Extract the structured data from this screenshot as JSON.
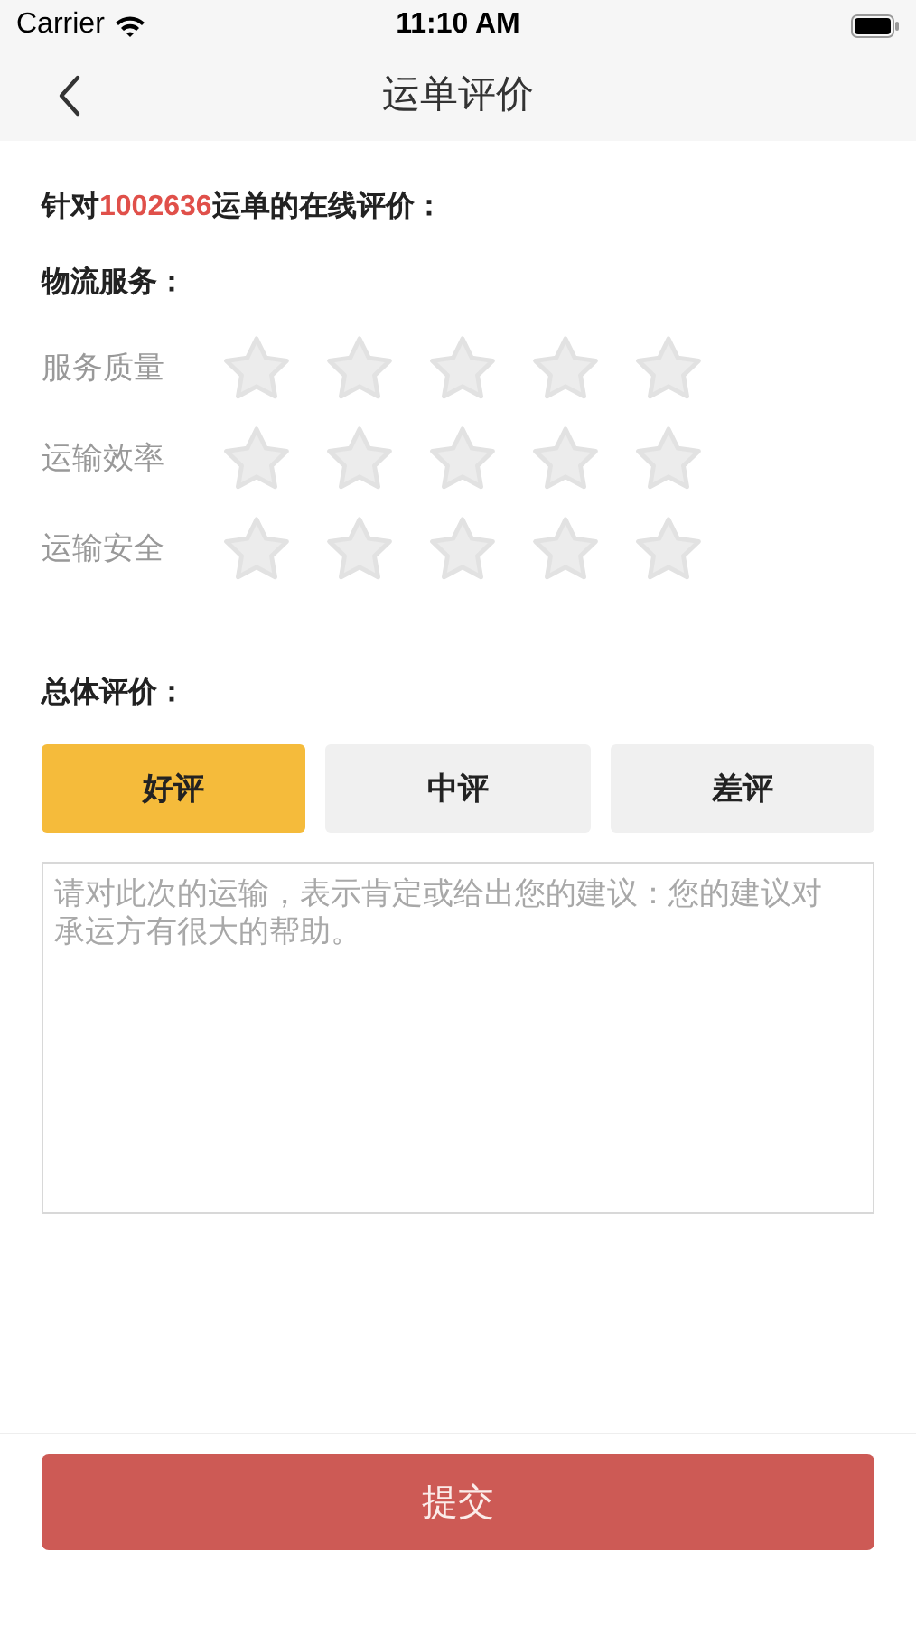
{
  "status_bar": {
    "carrier": "Carrier",
    "time": "11:10 AM"
  },
  "nav": {
    "title": "运单评价"
  },
  "heading": {
    "prefix": "针对",
    "order_number": "1002636",
    "suffix": "运单的在线评价："
  },
  "section_label": "物流服务：",
  "ratings": [
    {
      "label": "服务质量",
      "stars": 0
    },
    {
      "label": "运输效率",
      "stars": 0
    },
    {
      "label": "运输安全",
      "stars": 0
    }
  ],
  "overall_label": "总体评价：",
  "overall_options": [
    {
      "label": "好评",
      "selected": true
    },
    {
      "label": "中评",
      "selected": false
    },
    {
      "label": "差评",
      "selected": false
    }
  ],
  "comment": {
    "placeholder": "请对此次的运输，表示肯定或给出您的建议：您的建议对承运方有很大的帮助。"
  },
  "submit": "提交"
}
